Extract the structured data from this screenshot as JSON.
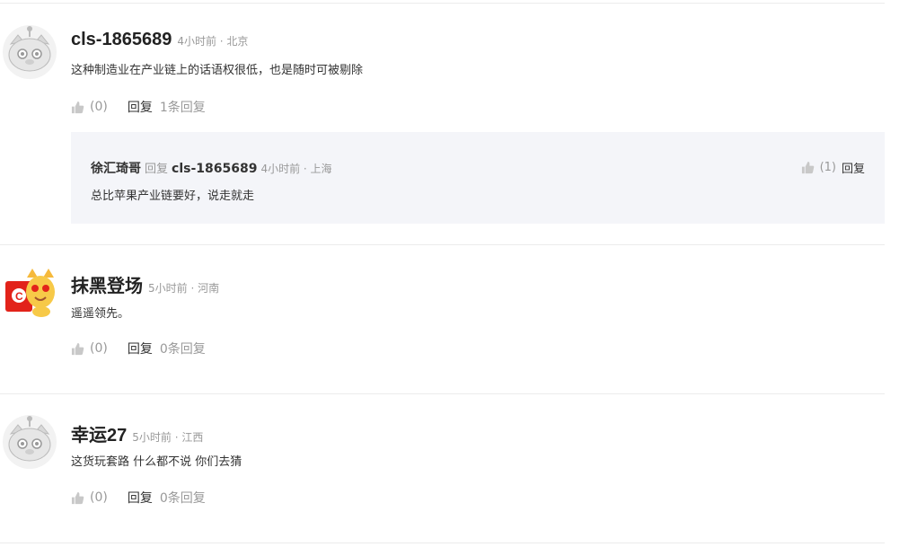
{
  "comments": [
    {
      "username": "cls-1865689",
      "meta": "4小时前 · 北京",
      "content": "这种制造业在产业链上的话语权很低，也是随时可被剔除",
      "likes": "(0)",
      "reply_label": "回复",
      "reply_count": "1条回复",
      "avatar": "cat-avatar-icon",
      "replies": [
        {
          "username": "徐汇琦哥",
          "reply_word": "回复",
          "target": "cls-1865689",
          "meta": "4小时前 · 上海",
          "content": "总比苹果产业链要好，说走就走",
          "likes": "(1)",
          "reply_label": "回复"
        }
      ]
    },
    {
      "username": "抹黑登场",
      "meta": "5小时前 · 河南",
      "content": "遥遥领先。",
      "likes": "(0)",
      "reply_label": "回复",
      "reply_count": "0条回复",
      "avatar": "cartoon-cat-avatar-icon"
    },
    {
      "username": "幸运27",
      "meta": "5小时前 · 江西",
      "content": "这货玩套路 什么都不说 你们去猜",
      "likes": "(0)",
      "reply_label": "回复",
      "reply_count": "0条回复",
      "avatar": "cat-avatar-icon"
    }
  ],
  "colors": {
    "username": "#222222",
    "meta": "#999999",
    "reply_bg": "#f4f5f9",
    "divider": "#ececec"
  }
}
